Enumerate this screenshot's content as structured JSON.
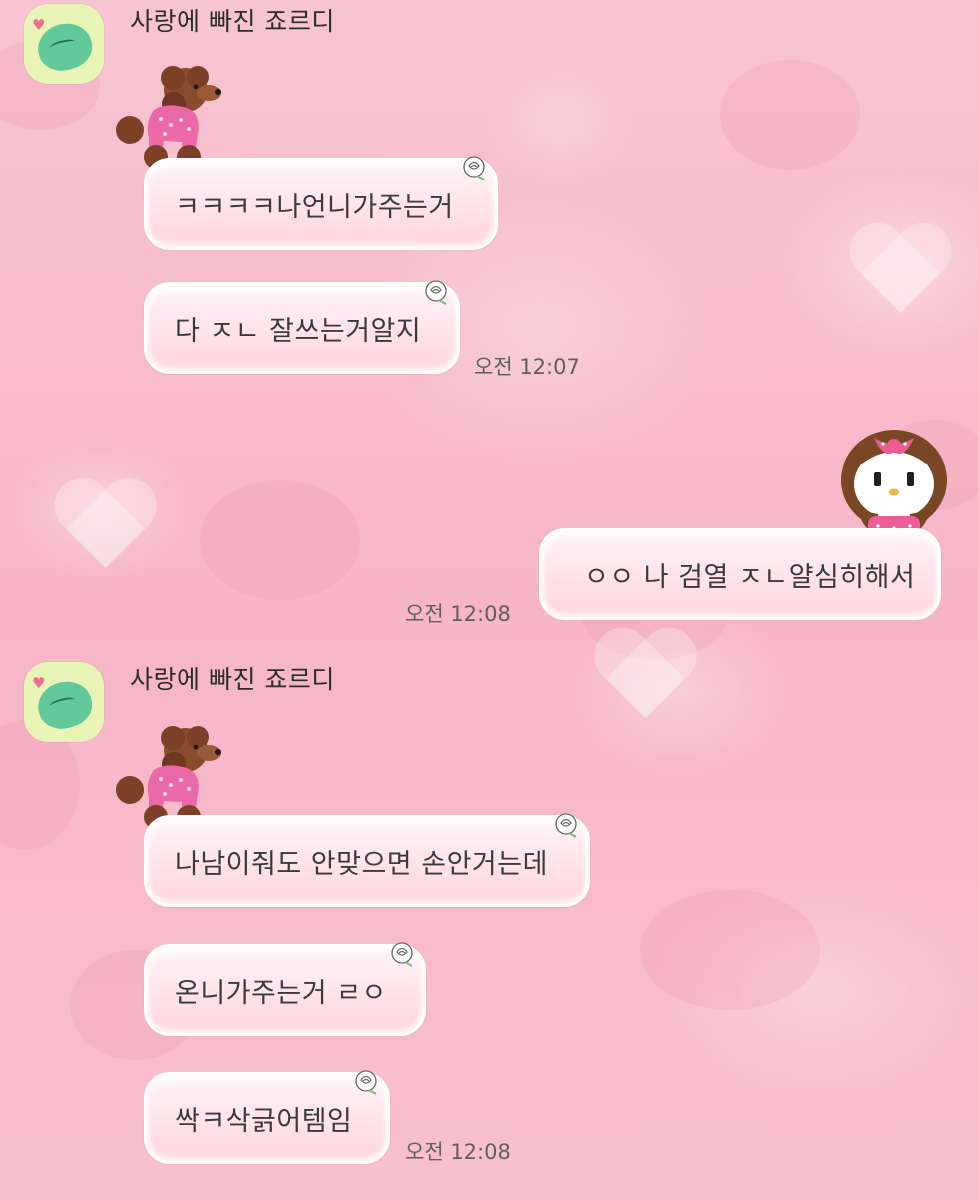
{
  "chat": {
    "partner_name": "사랑에 빠진 죠르디",
    "groups": [
      {
        "sender": "사랑에 빠진 죠르디",
        "messages": [
          "ㅋㅋㅋㅋ나언니가주는거",
          "다 ㅈㄴ 잘쓰는거알지"
        ],
        "time": "오전 12:07"
      },
      {
        "sender": "me",
        "messages": [
          "ㅇㅇ 나 검열 ㅈㄴ얄심히해서"
        ],
        "time": "오전 12:08"
      },
      {
        "sender": "사랑에 빠진 죠르디",
        "messages": [
          "나남이줘도 안맞으면 손안거는데",
          "온니가주는거 ㄹㅇ",
          "싹ㅋ삭긁어템임"
        ],
        "time": "오전 12:08"
      }
    ]
  },
  "theme": {
    "background": "#f7bccb",
    "bubble_fill": "#ffe2ea",
    "bubble_border": "#ffffff",
    "text_color": "#3a3a3a",
    "time_color": "#5f5f5f"
  },
  "icons": {
    "partner_avatar": "jordy-dinosaur-avatar",
    "partner_sticker": "poodle-dog-icon",
    "my_sticker": "girl-with-bow-icon",
    "bubble_decoration": "rose-icon"
  }
}
